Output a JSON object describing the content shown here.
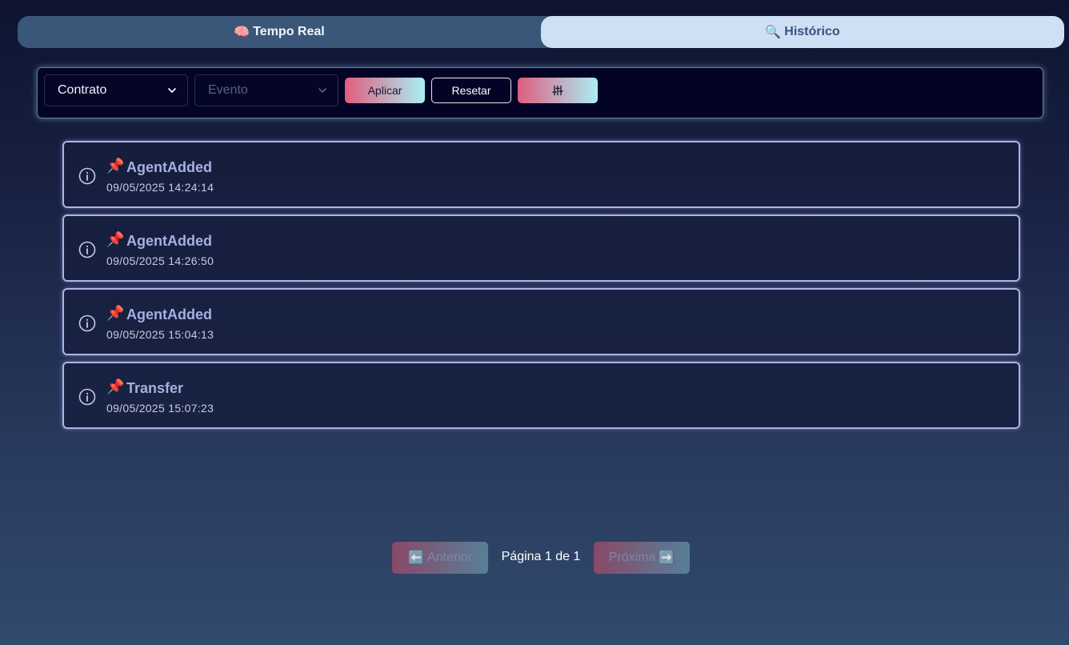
{
  "tabs": [
    {
      "label": "Tempo Real",
      "icon": "brain-icon"
    },
    {
      "label": "Histórico",
      "icon": "magnifier-icon"
    }
  ],
  "filters": {
    "contract": {
      "value": "Contrato"
    },
    "event": {
      "placeholder": "Evento"
    },
    "apply_label": "Aplicar",
    "reset_label": "Resetar",
    "adjust_icon": "sliders-icon"
  },
  "events": [
    {
      "icon": "pushpin-icon",
      "name": "AgentAdded",
      "timestamp": "09/05/2025 14:24:14"
    },
    {
      "icon": "pushpin-icon",
      "name": "AgentAdded",
      "timestamp": "09/05/2025 14:26:50"
    },
    {
      "icon": "pushpin-icon",
      "name": "AgentAdded",
      "timestamp": "09/05/2025 15:04:13"
    },
    {
      "icon": "pushpin-icon",
      "name": "Transfer",
      "timestamp": "09/05/2025 15:07:23"
    }
  ],
  "pagination": {
    "prev_label": "Anterior",
    "next_label": "Próxima",
    "page_text": "Página 1 de 1"
  },
  "colors": {
    "accent_gradient_start": "#e05d7e",
    "accent_gradient_end": "#a9eff5",
    "active_tab": "#cfe0f5"
  }
}
